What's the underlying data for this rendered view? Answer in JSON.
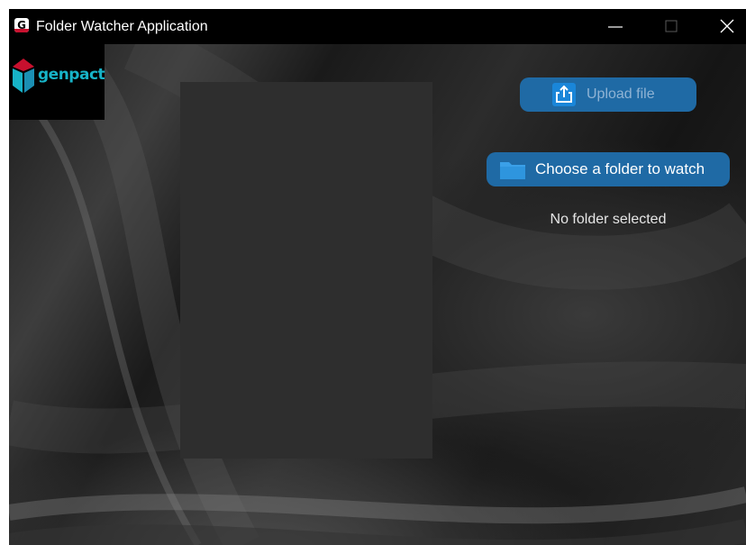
{
  "window": {
    "title": "Folder Watcher Application",
    "icon": "genpact-app-icon",
    "controls": [
      "minimize-icon",
      "maximize-icon",
      "close-icon"
    ]
  },
  "logo": {
    "text": "genpact",
    "color": "#17b3c7",
    "mark_colors": [
      "#c8102e",
      "#17b3c7"
    ]
  },
  "upload": {
    "label": "Upload file",
    "icon": "upload-icon",
    "color": "#1f6aa5"
  },
  "choose_folder": {
    "label": "Choose a folder to watch",
    "icon": "folder-icon",
    "color": "#1f6aa5"
  },
  "status": {
    "text": "No folder selected"
  }
}
